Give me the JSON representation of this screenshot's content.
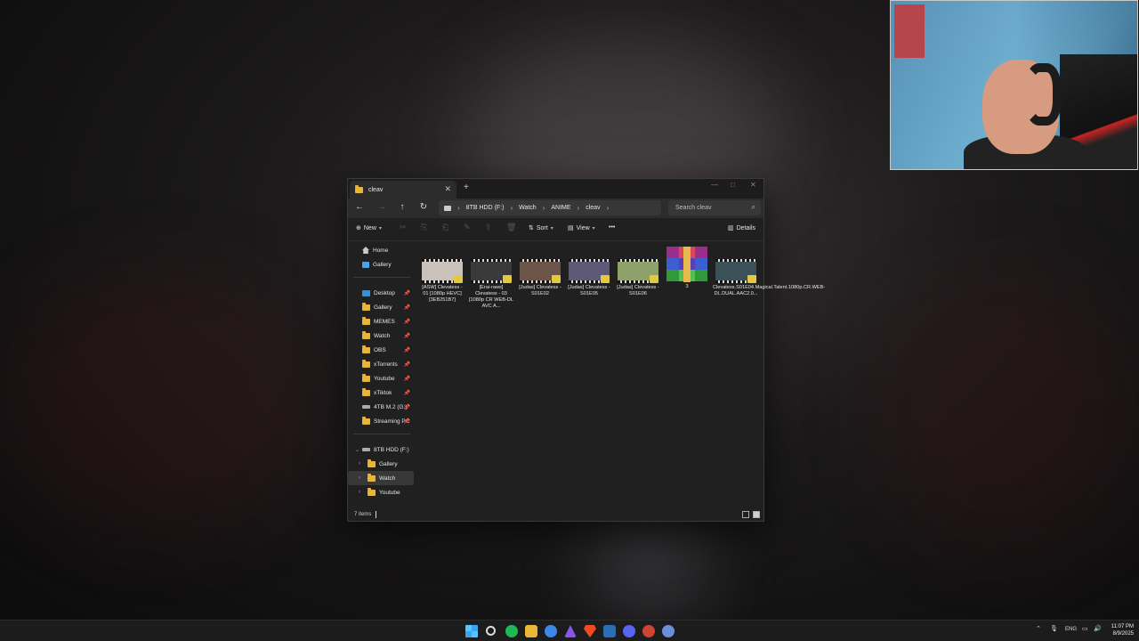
{
  "window": {
    "tab_title": "cleav",
    "tab_close": "✕",
    "new_tab": "+",
    "controls": {
      "minimize": "—",
      "maximize": "□",
      "close": "✕"
    }
  },
  "nav": {
    "back": "←",
    "forward": "→",
    "up": "↑",
    "refresh": "↻",
    "breadcrumb": [
      "8TB HDD (F:)",
      "Watch",
      "ANIME",
      "cleav"
    ],
    "search_placeholder": "Search cleav"
  },
  "commands": {
    "new_label": "New",
    "sort_label": "Sort",
    "view_label": "View",
    "more_label": "•••",
    "details_label": "Details"
  },
  "sidebar": {
    "top_items": [
      {
        "label": "Home",
        "icon": "home-icon"
      },
      {
        "label": "Gallery",
        "icon": "gallery-icon"
      }
    ],
    "pinned_items": [
      {
        "label": "Desktop",
        "icon": "desktop-icon"
      },
      {
        "label": "Gallery",
        "icon": "folder-icon"
      },
      {
        "label": "MEMES",
        "icon": "folder-icon"
      },
      {
        "label": "Watch",
        "icon": "folder-icon"
      },
      {
        "label": "OBS",
        "icon": "folder-icon"
      },
      {
        "label": "xTorrents",
        "icon": "folder-icon"
      },
      {
        "label": "Youtube",
        "icon": "folder-icon"
      },
      {
        "label": "xTiktok",
        "icon": "folder-icon"
      },
      {
        "label": "4TB M.2 (G:)",
        "icon": "drive-icon"
      },
      {
        "label": "Streaming PC",
        "icon": "folder-icon"
      }
    ],
    "drive_tree": {
      "drive_label": "8TB HDD (F:)",
      "children": [
        "Gallery",
        "Watch",
        "Youtube"
      ]
    }
  },
  "files": [
    {
      "name": "[ASW] Clevatess - 01 [1080p HEVC][3EB251B7]",
      "type": "video",
      "color": "#c9c2bb"
    },
    {
      "name": "[Erai-raws] Clevatess - 03 [1080p CR WEB-DL AVC A...",
      "type": "video",
      "color": "#3a3a3c"
    },
    {
      "name": "[Judas] Clevatess - S01E02",
      "type": "video",
      "color": "#6b5548"
    },
    {
      "name": "[Judas] Clevatess - S01E05",
      "type": "video",
      "color": "#5d5a78"
    },
    {
      "name": "[Judas] Clevatess - S01E06",
      "type": "video",
      "color": "#8fa16a"
    },
    {
      "name": "3",
      "type": "archive",
      "color": "#9b2d8c"
    },
    {
      "name": "Clevatess.S01E04.Magical.Talent.1080p.CR.WEB-DL.DUAL.AAC2.0...",
      "type": "video",
      "color": "#3c5058"
    }
  ],
  "status": {
    "item_count": "7 items"
  },
  "taskbar": {
    "tray_lang": "ENG",
    "time": "11:07 PM",
    "date": "8/9/2025"
  }
}
